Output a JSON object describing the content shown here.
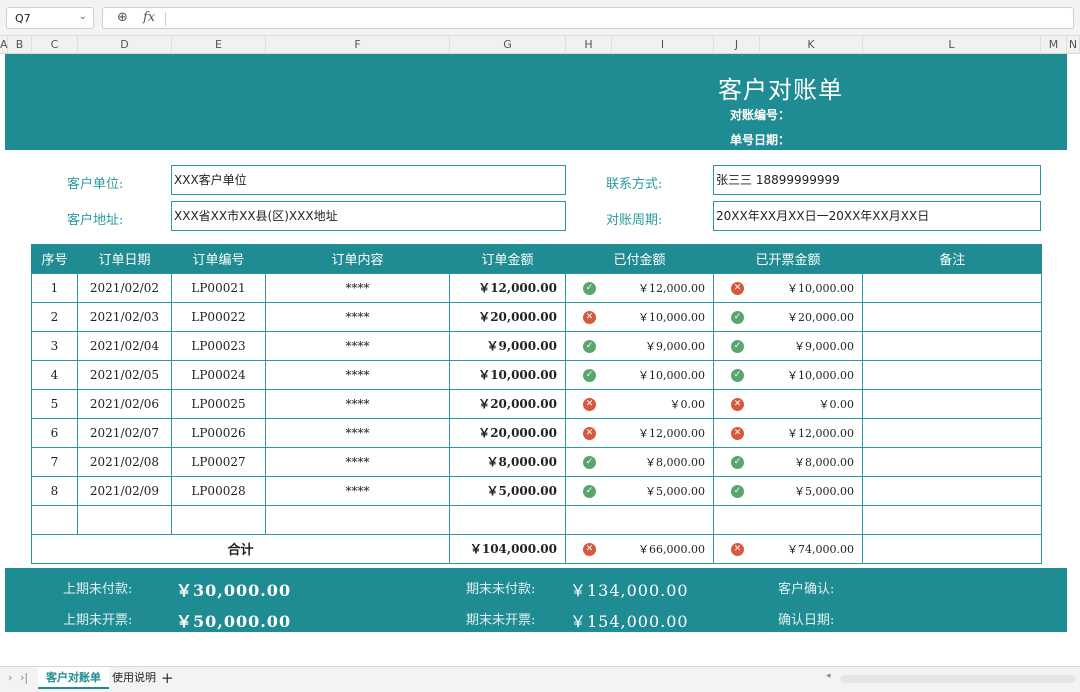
{
  "formula_bar": {
    "cell_ref": "Q7",
    "fx_label": "fx"
  },
  "columns": [
    "A",
    "B",
    "C",
    "D",
    "E",
    "F",
    "G",
    "H",
    "I",
    "J",
    "K",
    "L",
    "M",
    "N"
  ],
  "header": {
    "title": "客户对账单",
    "recon_no_label": "对账编号：",
    "doc_date_label": "单号日期："
  },
  "info": {
    "customer_unit_label": "客户单位:",
    "customer_unit_value": "XXX客户单位",
    "customer_addr_label": "客户地址:",
    "customer_addr_value": "XXX省XX市XX县(区)XXX地址",
    "contact_label": "联系方式:",
    "contact_value": "张三三    18899999999",
    "period_label": "对账周期:",
    "period_value": "20XX年XX月XX日一20XX年XX月XX日"
  },
  "table": {
    "headers": [
      "序号",
      "订单日期",
      "订单编号",
      "订单内容",
      "订单金额",
      "已付金额",
      "已开票金额",
      "备注"
    ],
    "rows": [
      {
        "no": "1",
        "date": "2021/02/02",
        "order": "LP00021",
        "content": "****",
        "amount": "￥12,000.00",
        "paid_ok": true,
        "paid": "￥12,000.00",
        "inv_ok": false,
        "invoiced": "￥10,000.00"
      },
      {
        "no": "2",
        "date": "2021/02/03",
        "order": "LP00022",
        "content": "****",
        "amount": "￥20,000.00",
        "paid_ok": false,
        "paid": "￥10,000.00",
        "inv_ok": true,
        "invoiced": "￥20,000.00"
      },
      {
        "no": "3",
        "date": "2021/02/04",
        "order": "LP00023",
        "content": "****",
        "amount": "￥9,000.00",
        "paid_ok": true,
        "paid": "￥9,000.00",
        "inv_ok": true,
        "invoiced": "￥9,000.00"
      },
      {
        "no": "4",
        "date": "2021/02/05",
        "order": "LP00024",
        "content": "****",
        "amount": "￥10,000.00",
        "paid_ok": true,
        "paid": "￥10,000.00",
        "inv_ok": true,
        "invoiced": "￥10,000.00"
      },
      {
        "no": "5",
        "date": "2021/02/06",
        "order": "LP00025",
        "content": "****",
        "amount": "￥20,000.00",
        "paid_ok": false,
        "paid": "￥0.00",
        "inv_ok": false,
        "invoiced": "￥0.00"
      },
      {
        "no": "6",
        "date": "2021/02/07",
        "order": "LP00026",
        "content": "****",
        "amount": "￥20,000.00",
        "paid_ok": false,
        "paid": "￥12,000.00",
        "inv_ok": false,
        "invoiced": "￥12,000.00"
      },
      {
        "no": "7",
        "date": "2021/02/08",
        "order": "LP00027",
        "content": "****",
        "amount": "￥8,000.00",
        "paid_ok": true,
        "paid": "￥8,000.00",
        "inv_ok": true,
        "invoiced": "￥8,000.00"
      },
      {
        "no": "8",
        "date": "2021/02/09",
        "order": "LP00028",
        "content": "****",
        "amount": "￥5,000.00",
        "paid_ok": true,
        "paid": "￥5,000.00",
        "inv_ok": true,
        "invoiced": "￥5,000.00"
      }
    ],
    "total_label": "合计",
    "total_amount": "￥104,000.00",
    "total_paid": "￥66,000.00",
    "total_invoiced": "￥74,000.00"
  },
  "footer": {
    "prev_unpaid_label": "上期未付款:",
    "prev_unpaid_value": "￥30,000.00",
    "prev_uninvoiced_label": "上期未开票:",
    "prev_uninvoiced_value": "￥50,000.00",
    "end_unpaid_label": "期末未付款:",
    "end_unpaid_value": "￥134,000.00",
    "end_uninvoiced_label": "期末未开票:",
    "end_uninvoiced_value": "￥154,000.00",
    "confirm_label": "客户确认:",
    "confirm_date_label": "确认日期:"
  },
  "sheet_tabs": {
    "active": "客户对账单",
    "other": "使用说明",
    "add": "+"
  },
  "colors": {
    "teal": "#1f8c93",
    "ok": "#5aa56e",
    "no": "#d9573f"
  }
}
